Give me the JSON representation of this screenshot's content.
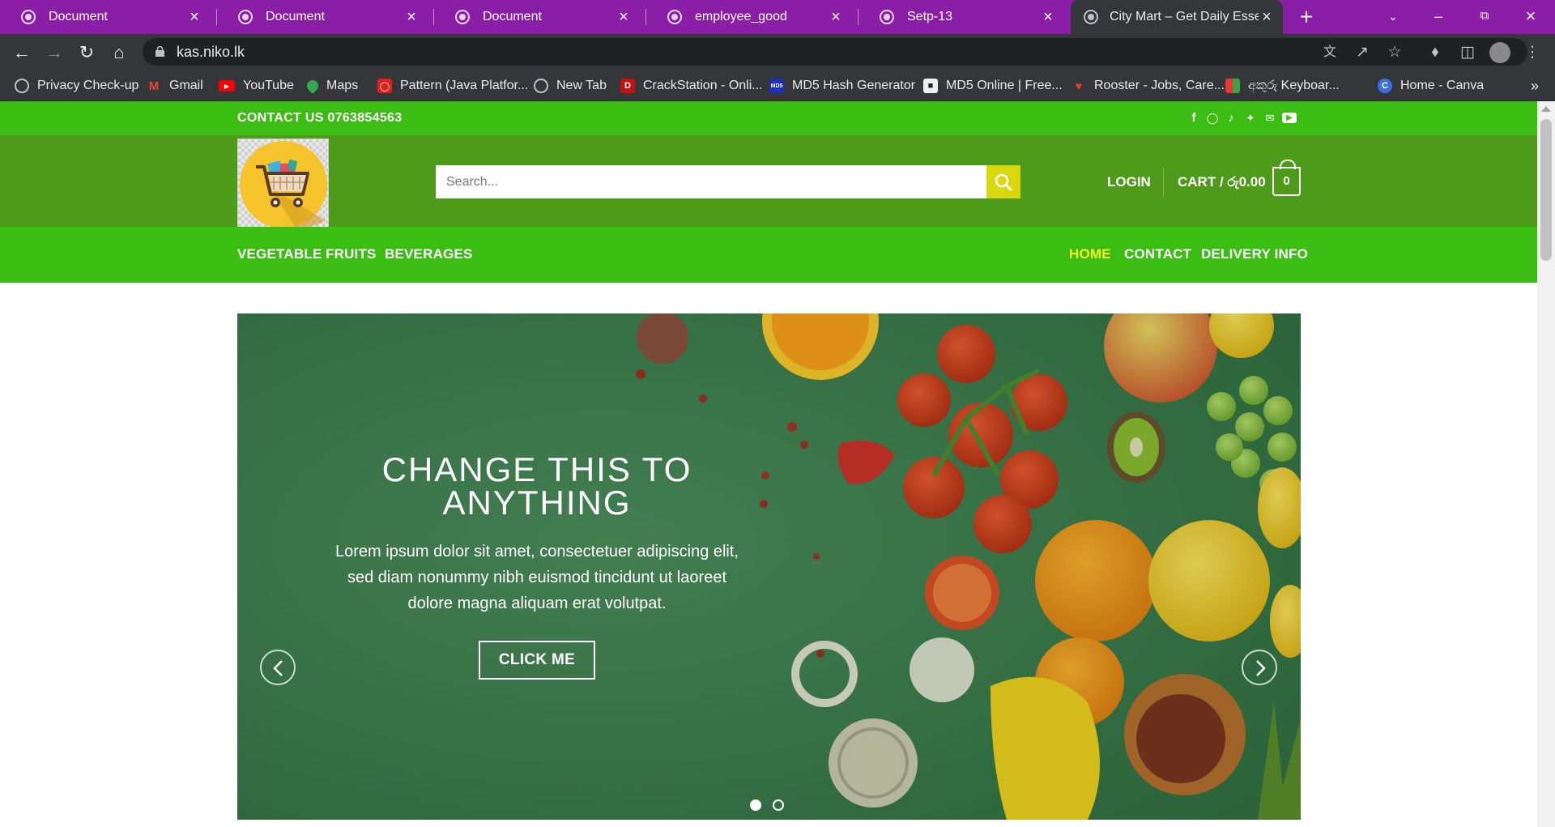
{
  "browser": {
    "tabs": [
      {
        "title": "Document",
        "active": false
      },
      {
        "title": "Document",
        "active": false
      },
      {
        "title": "Document",
        "active": false
      },
      {
        "title": "employee_good",
        "active": false
      },
      {
        "title": "Setp-13",
        "active": false
      },
      {
        "title": "City Mart – Get Daily Essent",
        "active": true
      }
    ],
    "url": "kas.niko.lk",
    "bookmarks": [
      {
        "label": "Privacy Check-up",
        "icon": "globe-icon"
      },
      {
        "label": "Gmail",
        "icon": "gmail-icon"
      },
      {
        "label": "YouTube",
        "icon": "youtube-icon"
      },
      {
        "label": "Maps",
        "icon": "maps-icon"
      },
      {
        "label": "Pattern (Java Platfor...",
        "icon": "oracle-icon"
      },
      {
        "label": "New Tab",
        "icon": "globe-icon"
      },
      {
        "label": "CrackStation - Onli...",
        "icon": "crackstation-icon"
      },
      {
        "label": "MD5 Hash Generator",
        "icon": "md5-icon"
      },
      {
        "label": "MD5 Online | Free...",
        "icon": "lock-icon"
      },
      {
        "label": "Rooster - Jobs, Care...",
        "icon": "rooster-icon"
      },
      {
        "label": "අකුරු Keyboar...",
        "icon": "keyboard-icon"
      },
      {
        "label": "Home - Canva",
        "icon": "canva-icon"
      }
    ],
    "more_bookmarks": "»",
    "accent": "#8a1ea6"
  },
  "site": {
    "contact": "CONTACT US 0763854563",
    "social": [
      "facebook-icon",
      "instagram-icon",
      "tiktok-icon",
      "twitter-icon",
      "email-icon",
      "youtube-icon"
    ],
    "search_placeholder": "Search...",
    "login": "LOGIN",
    "cart_label": "CART / රු0.00",
    "cart_count": "0",
    "nav_left": [
      "VEGETABLE",
      "FRUITS",
      "BEVERAGES"
    ],
    "nav_right": [
      "HOME",
      "CONTACT",
      "DELIVERY INFO"
    ],
    "active_nav": "HOME",
    "colors": {
      "topbar": "#3cbd14",
      "header": "#4e9a1a",
      "search_button": "#d9d70d",
      "active_nav": "#f3f01d"
    }
  },
  "slider": {
    "title": "CHANGE THIS TO ANYTHING",
    "text": "Lorem ipsum dolor sit amet, consectetuer adipiscing elit, sed diam nonummy nibh euismod tincidunt ut laoreet dolore magna aliquam erat volutpat.",
    "button": "CLICK ME",
    "slides_total": 2,
    "current_slide": 1
  }
}
